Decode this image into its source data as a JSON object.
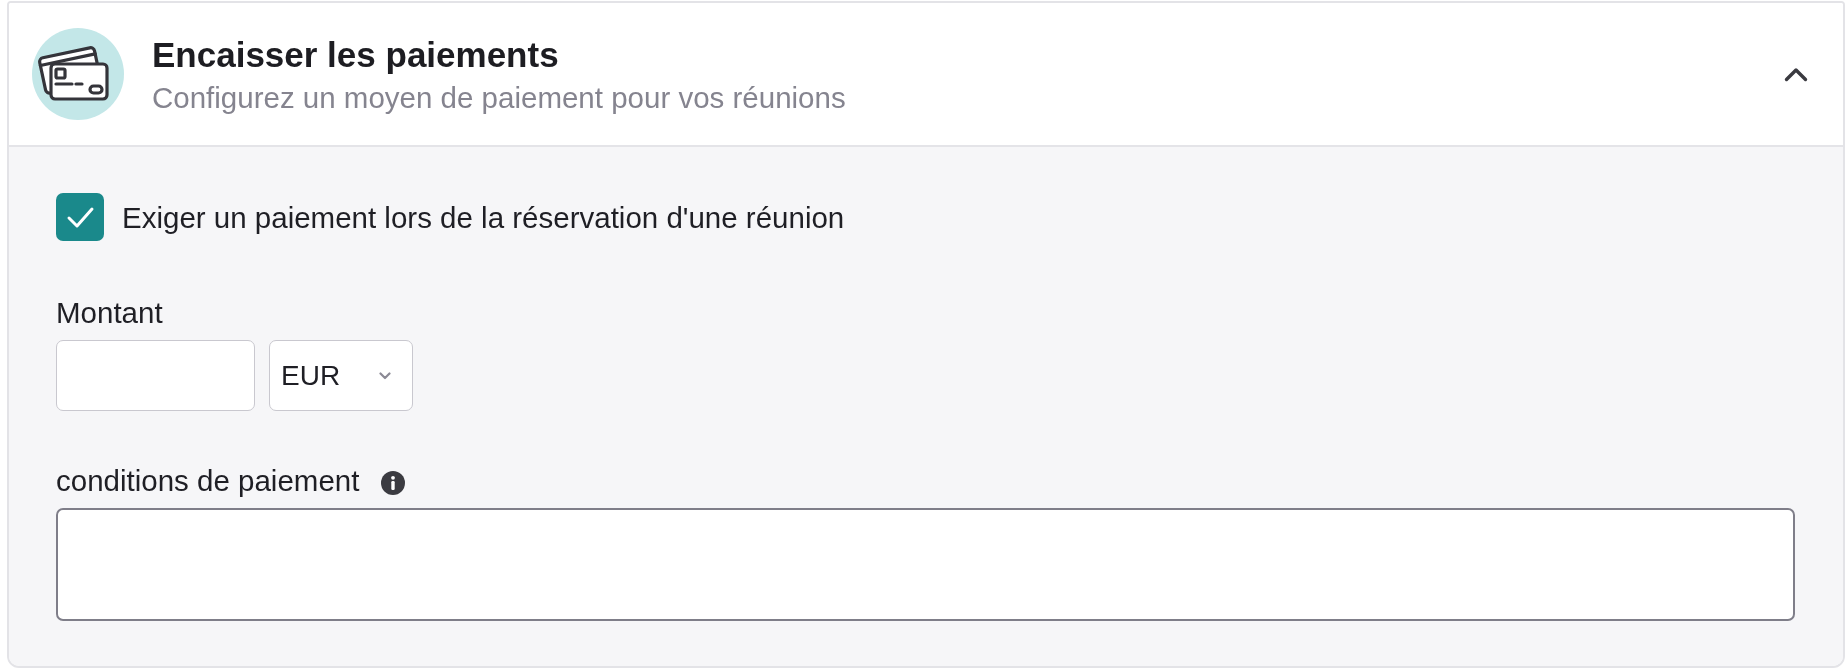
{
  "panel": {
    "title": "Encaisser les paiements",
    "subtitle": "Configurez un moyen de paiement pour vos réunions",
    "expanded": true
  },
  "require_payment": {
    "label": "Exiger un paiement lors de la réservation d'une réunion",
    "checked": true
  },
  "amount": {
    "label": "Montant",
    "currency": "EUR"
  },
  "payment_terms": {
    "label": "conditions de paiement"
  }
}
